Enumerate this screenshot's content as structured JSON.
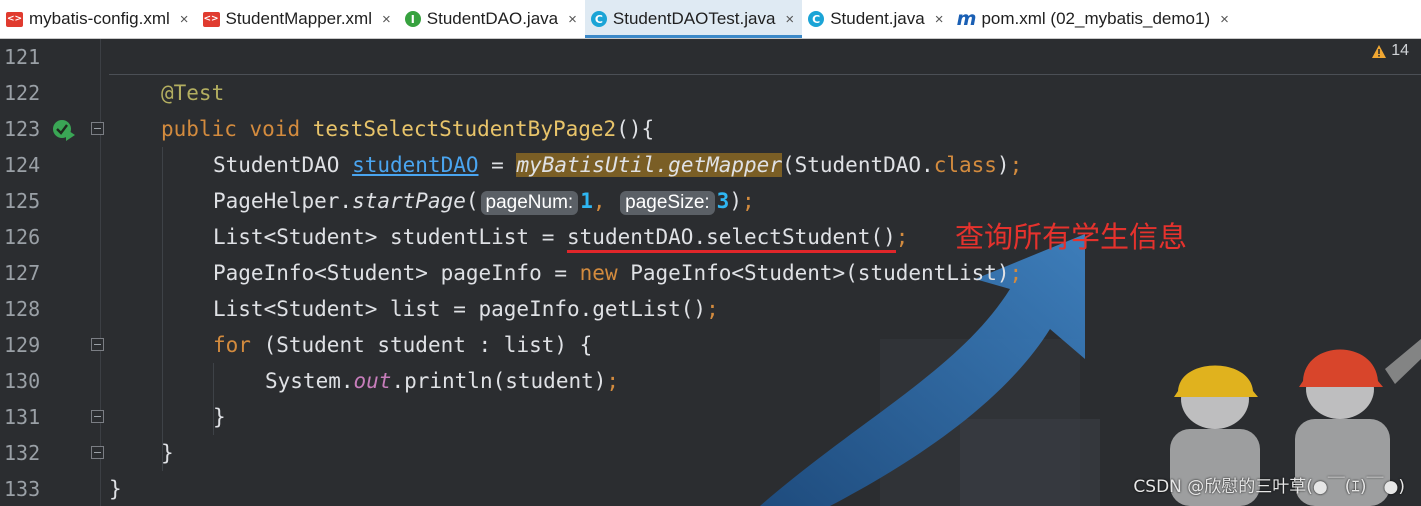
{
  "tabs": [
    {
      "label": "mybatis-config.xml",
      "icon": "xml-file-icon",
      "active": false
    },
    {
      "label": "StudentMapper.xml",
      "icon": "xml-file-icon",
      "active": false
    },
    {
      "label": "StudentDAO.java",
      "icon": "interface-icon",
      "active": false
    },
    {
      "label": "StudentDAOTest.java",
      "icon": "class-icon",
      "active": true
    },
    {
      "label": "Student.java",
      "icon": "class-icon",
      "active": false
    },
    {
      "label": "pom.xml (02_mybatis_demo1)",
      "icon": "maven-icon",
      "active": false
    }
  ],
  "tab_close_glyph": "×",
  "icon_glyphs": {
    "interface": "I",
    "class": "C",
    "xml": "<>",
    "maven": "m"
  },
  "warnings": {
    "icon": "warning-icon",
    "count": "14"
  },
  "line_numbers": [
    "121",
    "122",
    "123",
    "124",
    "125",
    "126",
    "127",
    "128",
    "129",
    "130",
    "131",
    "132",
    "133"
  ],
  "code": {
    "l122_annotation": "@Test",
    "l123_public": "public",
    "l123_void": "void",
    "l123_name": "testSelectStudentByPage2",
    "l123_rest": "(){",
    "l124_type": "StudentDAO ",
    "l124_var": "studentDAO",
    "l124_eq": " = ",
    "l124_call": "myBatisUtil.getMapper",
    "l124_arg": "(StudentDAO.",
    "l124_class": "class",
    "l124_close": ")",
    "l124_semi": ";",
    "l125_a": "PageHelper.",
    "l125_method": "startPage",
    "l125_paren": "(",
    "l125_hint1": "pageNum:",
    "l125_num1": "1",
    "l125_comma": ", ",
    "l125_hint2": "pageSize:",
    "l125_num2": "3",
    "l125_close": ")",
    "l125_semi": ";",
    "l126_a": "List<Student> studentList = ",
    "l126_underlined": "studentDAO.selectStudent()",
    "l126_semi": ";",
    "l127_a": "PageInfo<Student> pageInfo = ",
    "l127_new": "new",
    "l127_b": " PageInfo<Student>(studentList)",
    "l127_semi": ";",
    "l128_a": "List<Student> list = pageInfo.getList()",
    "l128_semi": ";",
    "l129_for": "for",
    "l129_b": " (Student student : list) {",
    "l130_a": "System.",
    "l130_field": "out",
    "l130_b": ".println(student)",
    "l130_semi": ";",
    "l131": "}",
    "l132": "}",
    "l133": "}"
  },
  "annotation_note": "查询所有学生信息",
  "watermark": "CSDN @欣慰的三叶草(●￣(ｴ)￣●)",
  "colors": {
    "editor_bg": "#2b2d30",
    "keyword": "#d38b3e",
    "annotation": "#b3ae60",
    "method_decl": "#e8c46a",
    "field": "#c77dbb",
    "link": "#4aa5f0",
    "number": "#2fb6f2",
    "note_red": "#e5322d",
    "active_tab_underline": "#3c89c8"
  }
}
